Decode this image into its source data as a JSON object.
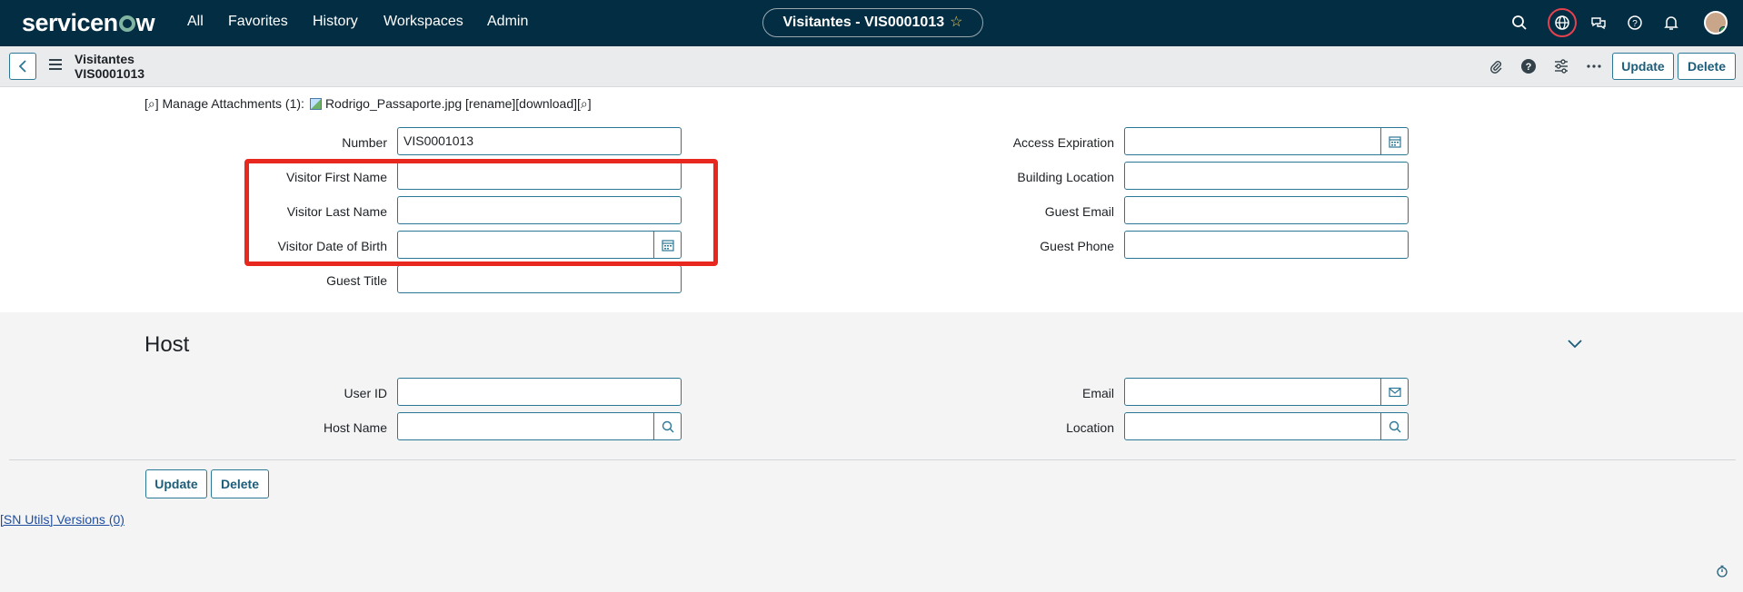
{
  "topnav": {
    "logo": "servicenow",
    "links": [
      "All",
      "Favorites",
      "History",
      "Workspaces",
      "Admin"
    ],
    "record_pill": "Visitantes - VIS0001013"
  },
  "header": {
    "table": "Visitantes",
    "number": "VIS0001013",
    "update_label": "Update",
    "delete_label": "Delete"
  },
  "attachments": {
    "manage_prefix": "[⌕] Manage Attachments (1):",
    "file_name": "Rodrigo_Passaporte.jpg",
    "actions": "[rename][download][⌕]"
  },
  "form": {
    "left": [
      {
        "label": "Number",
        "value": "VIS0001013"
      },
      {
        "label": "Visitor First Name",
        "value": ""
      },
      {
        "label": "Visitor Last Name",
        "value": ""
      },
      {
        "label": "Visitor Date of Birth",
        "value": ""
      },
      {
        "label": "Guest Title",
        "value": ""
      }
    ],
    "right": [
      {
        "label": "Access Expiration",
        "value": ""
      },
      {
        "label": "Building Location",
        "value": ""
      },
      {
        "label": "Guest Email",
        "value": ""
      },
      {
        "label": "Guest Phone",
        "value": ""
      }
    ]
  },
  "host": {
    "title": "Host",
    "left": [
      {
        "label": "User ID",
        "value": ""
      },
      {
        "label": "Host Name",
        "value": ""
      }
    ],
    "right": [
      {
        "label": "Email",
        "value": ""
      },
      {
        "label": "Location",
        "value": ""
      }
    ]
  },
  "footer": {
    "update_label": "Update",
    "delete_label": "Delete",
    "sn_utils": "[SN Utils] Versions (0)"
  },
  "colors": {
    "nav_bg": "#032d42",
    "accent": "#2b7896",
    "highlight": "#e8281e"
  }
}
